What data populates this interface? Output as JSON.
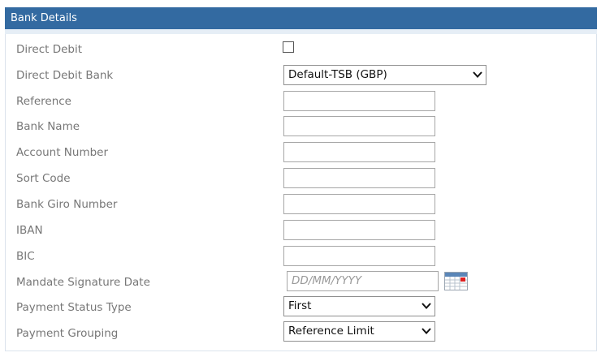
{
  "panel": {
    "title": "Bank Details"
  },
  "fields": {
    "direct_debit": {
      "label": "Direct Debit",
      "checked": false
    },
    "direct_debit_bank": {
      "label": "Direct Debit Bank",
      "value": "Default-TSB (GBP)"
    },
    "reference": {
      "label": "Reference",
      "value": ""
    },
    "bank_name": {
      "label": "Bank Name",
      "value": ""
    },
    "account_number": {
      "label": "Account Number",
      "value": ""
    },
    "sort_code": {
      "label": "Sort Code",
      "value": ""
    },
    "bank_giro_number": {
      "label": "Bank Giro Number",
      "value": ""
    },
    "iban": {
      "label": "IBAN",
      "value": ""
    },
    "bic": {
      "label": "BIC",
      "value": ""
    },
    "mandate_signature_date": {
      "label": "Mandate Signature Date",
      "placeholder": "DD/MM/YYYY"
    },
    "payment_status_type": {
      "label": "Payment Status Type",
      "value": "First"
    },
    "payment_grouping": {
      "label": "Payment Grouping",
      "value": "Reference Limit"
    }
  },
  "colors": {
    "header": "#336aa1",
    "header_strip": "#e6eef6",
    "label": "#777777",
    "calendar_marker": "#e02020"
  },
  "icons": {
    "dropdown": "chevron-down-icon",
    "date_picker": "calendar-icon"
  }
}
